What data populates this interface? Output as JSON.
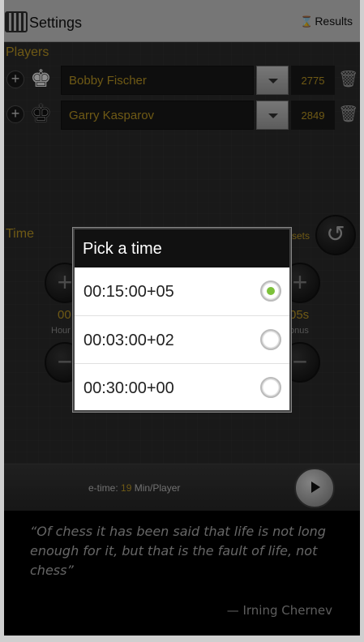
{
  "actionbar": {
    "title": "Settings",
    "results_label": "Results",
    "results_icon": "hourglass-icon"
  },
  "players": {
    "label": "Players",
    "items": [
      {
        "name": "Bobby Fischer",
        "rating": "2775",
        "piece": "white-king"
      },
      {
        "name": "Garry Kasparov",
        "rating": "2849",
        "piece": "black-king"
      }
    ]
  },
  "time": {
    "label": "Time",
    "presets_label": "sets",
    "hours_value": "00",
    "hours_label": "Hour",
    "bonus_value": "05s",
    "bonus_label": "onus"
  },
  "dialog": {
    "title": "Pick a time",
    "options": [
      {
        "label": "00:15:00+05",
        "selected": true
      },
      {
        "label": "00:03:00+02",
        "selected": false
      },
      {
        "label": "00:30:00+00",
        "selected": false
      }
    ]
  },
  "bottom": {
    "etime_prefix": "e-time: ",
    "etime_value": "19",
    "etime_suffix": " Min/Player"
  },
  "quote": {
    "text": "“Of chess it has been said that life is not long enough for it, but that is the fault of life, not chess”",
    "author": "— Irning Chernev"
  },
  "colors": {
    "accent": "#c9a227",
    "radio_selected": "#7cc13a"
  }
}
